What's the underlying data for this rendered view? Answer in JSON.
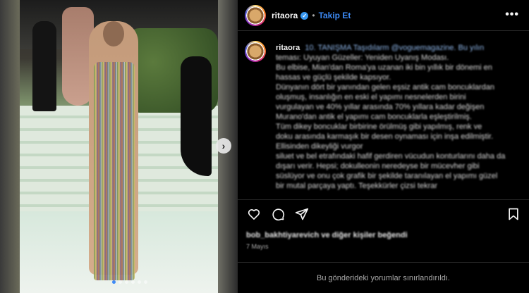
{
  "post": {
    "username": "ritaora",
    "follow_label": "Takip Et",
    "more_icon": "more-horizontal-icon",
    "verified_icon": "verified-badge-icon"
  },
  "caption": {
    "username": "ritaora",
    "lines": [
      "10. TANIŞMA Taşıdılarm @voguemagazine. Bu yılın",
      "teması: Uyuyan Güzeller: Yeniden Uyanış Modası.",
      "Bu elbise, Mian'dan Roma'ya uzanan iki bin yıllık bir dönemi en",
      "hassas ve güçlü şekilde kapsıyor.",
      "Dünyanın dört bir yanından gelen eşsiz antik cam boncuklardan",
      "oluşmuş, insanlığın en eski el yapımı nesnelerden birini",
      "vurgulayan ve 40% yıllar arasında 70% yıllara kadar değişen",
      "Murano'dan antik el yapımı cam boncuklarla eşleştirilmiş.",
      "Tüm dikey boncuklar birbirine örülmüş gibi yapılmış, renk ve",
      "doku arasında karmaşık bir desen oynaması için inşa edilmiştir.",
      "Ellisinden dikeyliği vurgor",
      "siluet ve bel etrafındaki hafif gerdiren vücudun konturlarını daha da",
      "dışarı verir. Hepsi; dokulleonin neredeyse bir mücevher gibi",
      "süslüyor ve onu çok grafik bir şekilde taranılayan el yapımı güzel",
      "bir mutal parçaya yaptı. Teşekkürler çizsi tekrar"
    ]
  },
  "actions": {
    "like_icon": "heart-icon",
    "comment_icon": "comment-icon",
    "share_icon": "share-icon",
    "save_icon": "bookmark-icon"
  },
  "likes_text": "bob_bakhtiyarevich ve diğer kişiler beğendi",
  "date_text": "7 Mayıs",
  "comments_limited": "Bu gönderideki yorumlar sınırlandırıldı.",
  "carousel": {
    "next_icon": "chevron-right-icon",
    "slide_count": 6,
    "active_index": 0
  },
  "colors": {
    "accent": "#3d8bf7",
    "background": "#000000",
    "text_secondary": "#a8a8a8"
  }
}
